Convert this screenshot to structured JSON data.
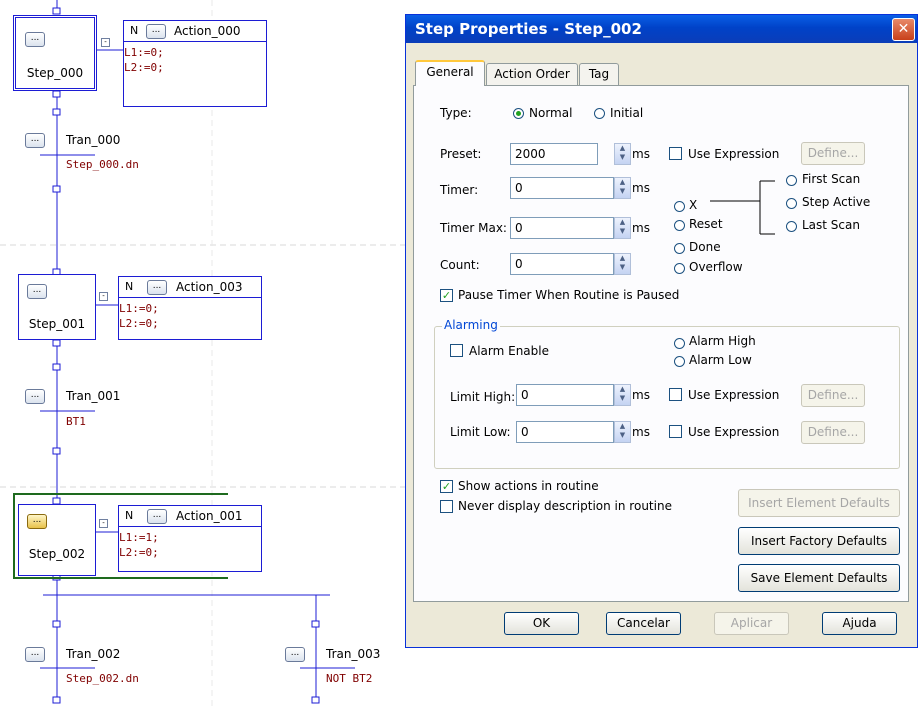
{
  "sfc": {
    "ellipsis": "...",
    "collapse": "-",
    "steps": [
      {
        "name": "Step_000"
      },
      {
        "name": "Step_001"
      },
      {
        "name": "Step_002"
      }
    ],
    "actions": [
      {
        "qualifier": "N",
        "name": "Action_000",
        "line1": "L1:=0;",
        "line2": "L2:=0;"
      },
      {
        "qualifier": "N",
        "name": "Action_003",
        "line1": "L1:=0;",
        "line2": "L2:=0;"
      },
      {
        "qualifier": "N",
        "name": "Action_001",
        "line1": "L1:=1;",
        "line2": "L2:=0;"
      }
    ],
    "transitions": [
      {
        "name": "Tran_000",
        "expr": "Step_000.dn"
      },
      {
        "name": "Tran_001",
        "expr": "BT1"
      },
      {
        "name": "Tran_002",
        "expr": "Step_002.dn"
      },
      {
        "name": "Tran_003",
        "expr": "NOT BT2"
      }
    ]
  },
  "dialog": {
    "title": "Step Properties - Step_002",
    "close_glyph": "✕",
    "tabs": [
      "General",
      "Action Order",
      "Tag"
    ],
    "type_label": "Type:",
    "type_normal": "Normal",
    "type_initial": "Initial",
    "preset_label": "Preset:",
    "preset_value": "2000",
    "timer_label": "Timer:",
    "timer_value": "0",
    "timer_max_label": "Timer Max:",
    "timer_max_value": "0",
    "count_label": "Count:",
    "count_value": "0",
    "ms": "ms",
    "use_expression": "Use Expression",
    "define": "Define...",
    "radio_x": "X",
    "radio_reset": "Reset",
    "radio_done": "Done",
    "radio_overflow": "Overflow",
    "radio_first_scan": "First Scan",
    "radio_step_active": "Step Active",
    "radio_last_scan": "Last Scan",
    "pause_timer": "Pause Timer When Routine is Paused",
    "alarming_title": "Alarming",
    "alarm_enable": "Alarm Enable",
    "alarm_high": "Alarm High",
    "alarm_low": "Alarm Low",
    "limit_high_label": "Limit High:",
    "limit_high_value": "0",
    "limit_low_label": "Limit Low:",
    "limit_low_value": "0",
    "show_actions": "Show actions in routine",
    "never_display": "Never display description in routine",
    "insert_element_defaults": "Insert Element Defaults",
    "insert_factory_defaults": "Insert Factory Defaults",
    "save_element_defaults": "Save Element Defaults",
    "ok": "OK",
    "cancel": "Cancelar",
    "apply": "Aplicar",
    "help": "Ajuda"
  },
  "colors": {
    "wire": "#1c1cd4",
    "code": "#800000",
    "selection": "#1e6a1e",
    "title_bar": "#0042c8",
    "dialog_bg": "#ece9d8"
  }
}
